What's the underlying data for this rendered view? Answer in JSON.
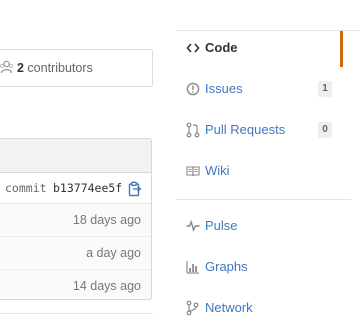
{
  "contributors": {
    "count": "2",
    "label": " contributors"
  },
  "file_table": {
    "commit_label": "commit",
    "commit_sha": "b13774ee5f",
    "rows": [
      {
        "age": "18 days ago"
      },
      {
        "age": "a day ago"
      },
      {
        "age": "14 days ago"
      }
    ]
  },
  "nav": {
    "code": {
      "label": "Code",
      "icon": "code-icon"
    },
    "issues": {
      "label": "Issues",
      "count": "1",
      "icon": "issue-opened-icon"
    },
    "pull_requests": {
      "label": "Pull Requests",
      "count": "0",
      "icon": "git-pull-request-icon"
    },
    "wiki": {
      "label": "Wiki",
      "icon": "book-icon"
    },
    "pulse": {
      "label": "Pulse",
      "icon": "pulse-icon"
    },
    "graphs": {
      "label": "Graphs",
      "icon": "graph-icon"
    },
    "network": {
      "label": "Network",
      "icon": "git-branch-icon"
    }
  },
  "colors": {
    "link": "#4078c0",
    "selected_accent": "#d26911"
  }
}
